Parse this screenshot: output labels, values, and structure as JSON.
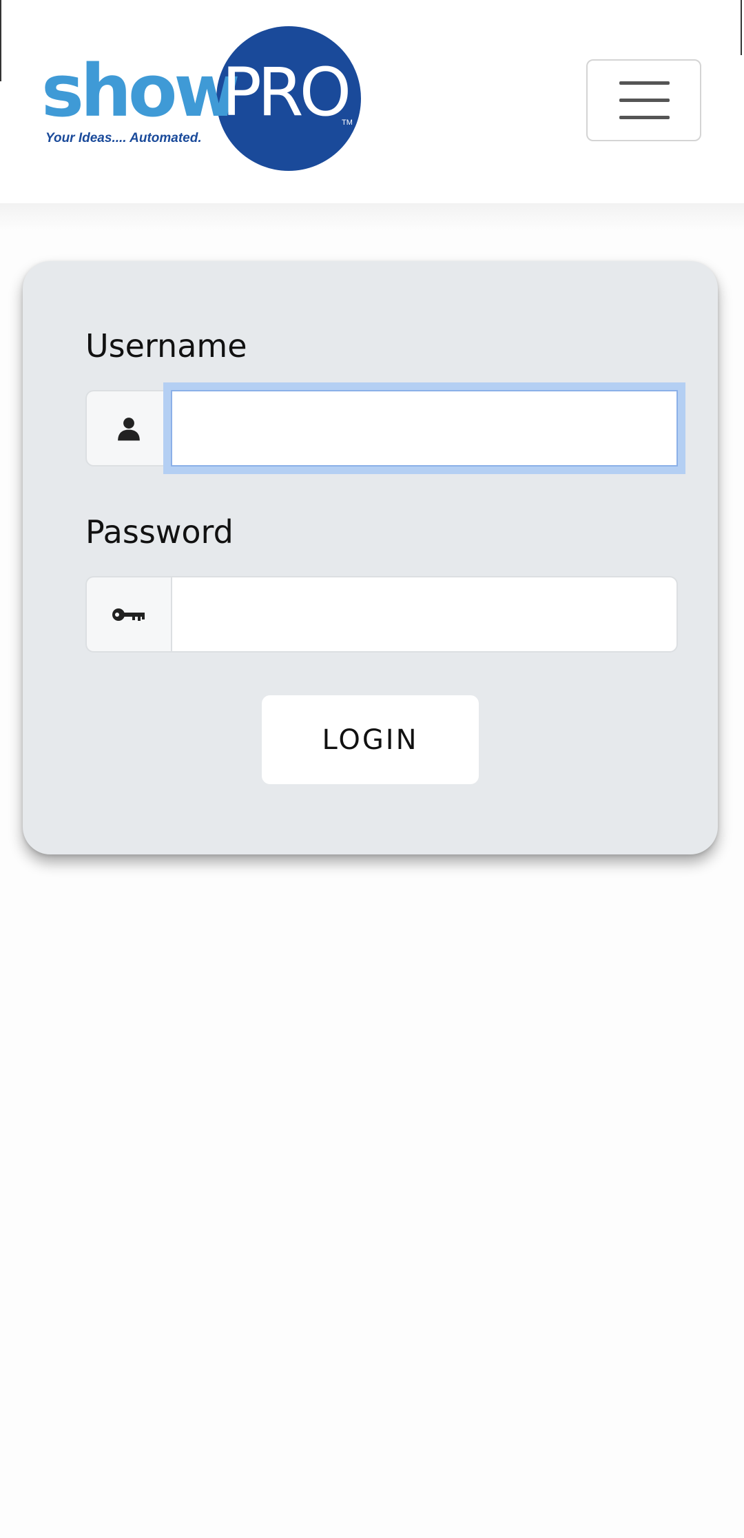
{
  "header": {
    "logo": {
      "word_show": "show",
      "word_pro": "PRO",
      "trademark": "TM",
      "tagline": "Your Ideas.... Automated.",
      "colors": {
        "show": "#3f9ad6",
        "circle": "#1a4a9a"
      }
    },
    "menu_toggle_icon": "hamburger-icon"
  },
  "login_form": {
    "username": {
      "label": "Username",
      "icon": "user-icon",
      "value": "",
      "placeholder": ""
    },
    "password": {
      "label": "Password",
      "icon": "key-icon",
      "value": "",
      "placeholder": ""
    },
    "submit_label": "LOGIN"
  },
  "colors": {
    "card_background": "#e6e9ec",
    "focus_ring": "#b4cff3"
  }
}
